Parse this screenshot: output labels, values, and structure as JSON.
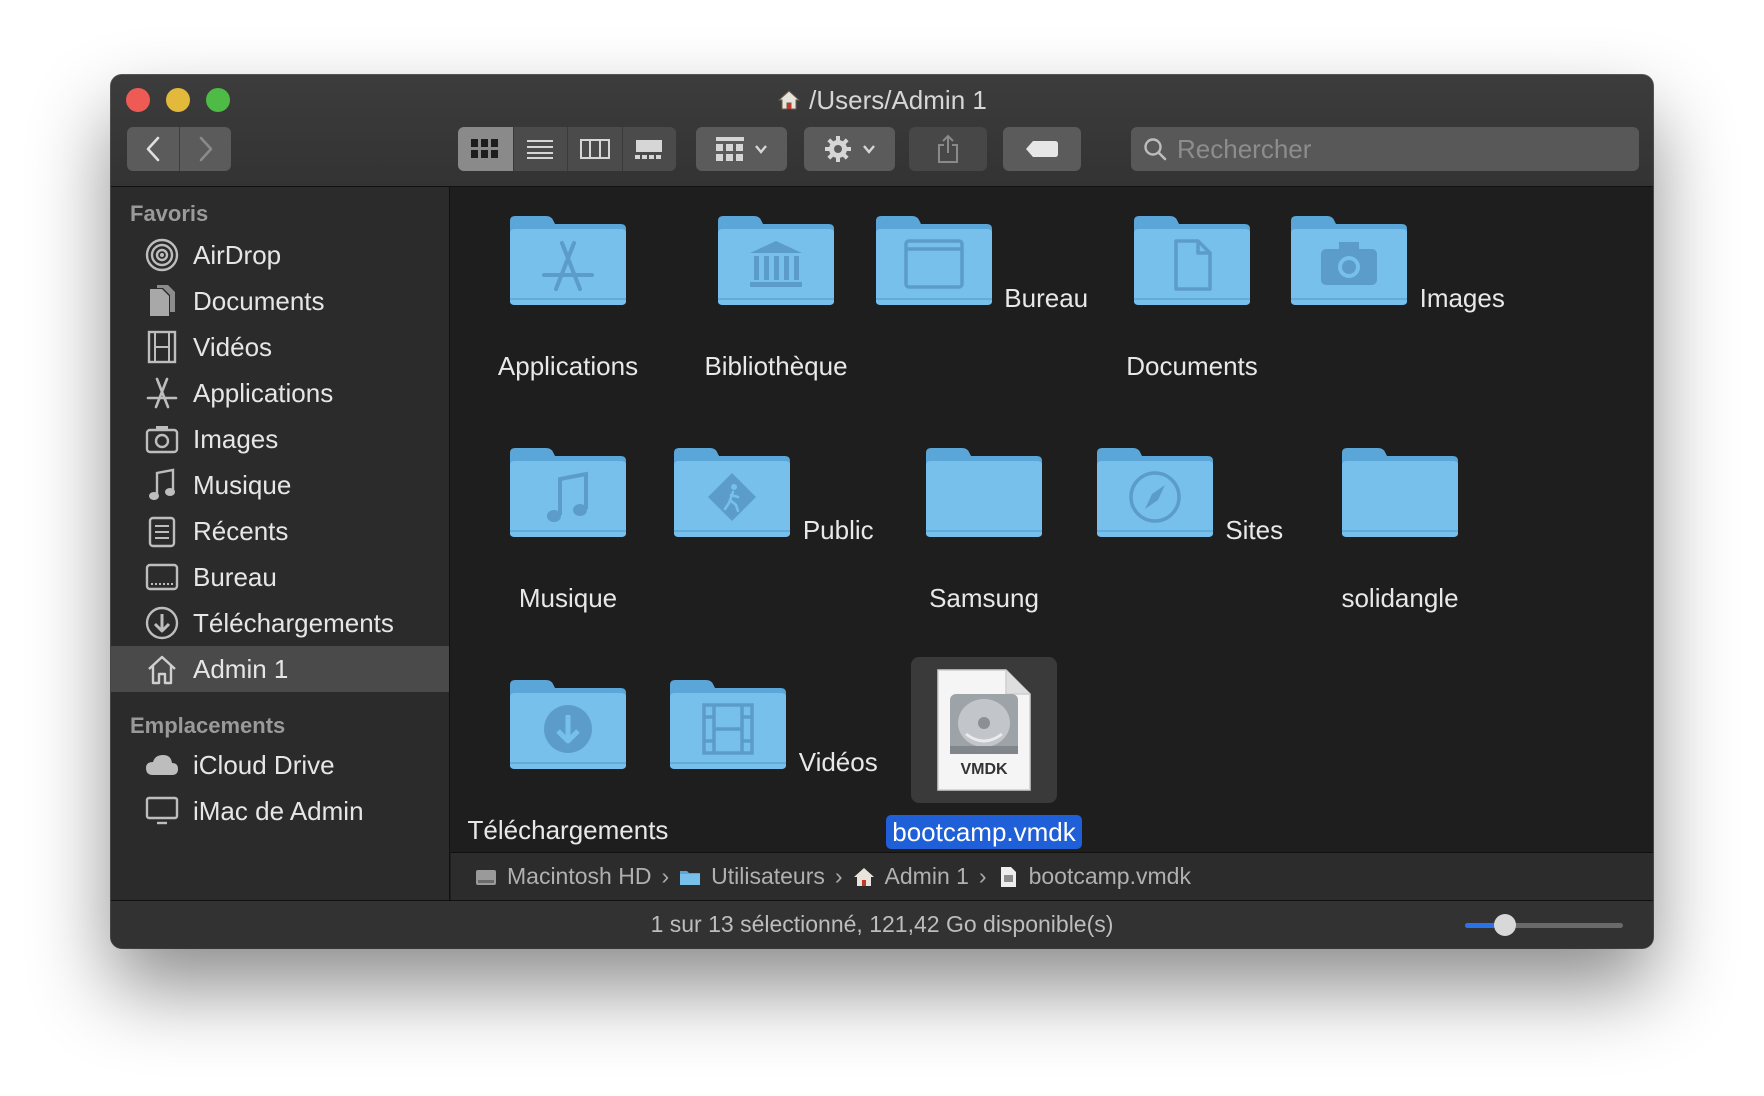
{
  "window": {
    "title": "/Users/Admin 1"
  },
  "toolbar": {
    "back_icon": "chevron-left-icon",
    "forward_icon": "chevron-right-icon",
    "views": [
      "icon-view",
      "list-view",
      "column-view",
      "gallery-view"
    ],
    "active_view": "icon-view",
    "search_placeholder": "Rechercher"
  },
  "sidebar": {
    "favorites_heading": "Favoris",
    "favorites": [
      {
        "label": "AirDrop",
        "icon": "airdrop-icon"
      },
      {
        "label": "Documents",
        "icon": "documents-icon"
      },
      {
        "label": "Vidéos",
        "icon": "film-icon"
      },
      {
        "label": "Applications",
        "icon": "applications-icon"
      },
      {
        "label": "Images",
        "icon": "camera-icon"
      },
      {
        "label": "Musique",
        "icon": "music-note-icon"
      },
      {
        "label": "Récents",
        "icon": "recents-icon"
      },
      {
        "label": "Bureau",
        "icon": "desktop-icon"
      },
      {
        "label": "Téléchargements",
        "icon": "download-icon"
      },
      {
        "label": "Admin 1",
        "icon": "home-icon",
        "selected": true
      }
    ],
    "locations_heading": "Emplacements",
    "locations": [
      {
        "label": "iCloud Drive",
        "icon": "cloud-icon"
      },
      {
        "label": "iMac de Admin",
        "icon": "computer-icon"
      }
    ]
  },
  "items": [
    {
      "label": "Applications",
      "glyph": "applications-icon"
    },
    {
      "label": "Bibliothèque",
      "glyph": "library-icon"
    },
    {
      "label": "Bureau",
      "glyph": "desktop-icon"
    },
    {
      "label": "Documents",
      "glyph": "document-icon"
    },
    {
      "label": "Images",
      "glyph": "camera-icon"
    },
    {
      "label": "Musique",
      "glyph": "music-note-icon"
    },
    {
      "label": "Public",
      "glyph": "public-icon"
    },
    {
      "label": "Samsung",
      "glyph": ""
    },
    {
      "label": "Sites",
      "glyph": "compass-icon"
    },
    {
      "label": "solidangle",
      "glyph": ""
    },
    {
      "label": "Téléchargements",
      "glyph": "download-icon"
    },
    {
      "label": "Vidéos",
      "glyph": "film-icon"
    },
    {
      "label": "bootcamp.vmdk",
      "glyph": "vmdk-file-icon",
      "file_badge": "VMDK",
      "selected": true
    }
  ],
  "pathbar": [
    {
      "label": "Macintosh HD",
      "icon": "hard-drive-icon"
    },
    {
      "label": "Utilisateurs",
      "icon": "folder-icon"
    },
    {
      "label": "Admin 1",
      "icon": "home-icon"
    },
    {
      "label": "bootcamp.vmdk",
      "icon": "file-icon"
    }
  ],
  "status": {
    "text": "1 sur 13 sélectionné, 121,42 Go disponible(s)",
    "icon_size_fraction": 0.25
  },
  "colors": {
    "folder": "#6cb8e8",
    "selection": "#1f5fd8",
    "accent": "#2a72e8"
  }
}
